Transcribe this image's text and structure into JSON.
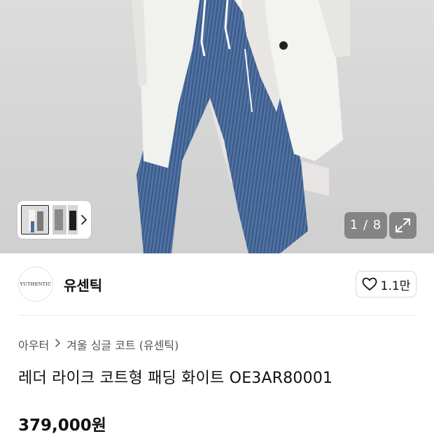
{
  "gallery": {
    "counter": "1 / 8"
  },
  "brand": {
    "logo_text": "YUTHENTIC",
    "name": "유센틱",
    "likes": "1.1만"
  },
  "product": {
    "breadcrumb": [
      "아우터",
      "겨울 싱글 코트 (유센틱)"
    ],
    "title": "레더 라이크 코트형 패딩 화이트 OE3AR80001",
    "price": "379,000원"
  },
  "icons": {
    "thumb_arrow": "chevron-right-icon",
    "expand": "expand-icon",
    "like": "heart-icon"
  }
}
